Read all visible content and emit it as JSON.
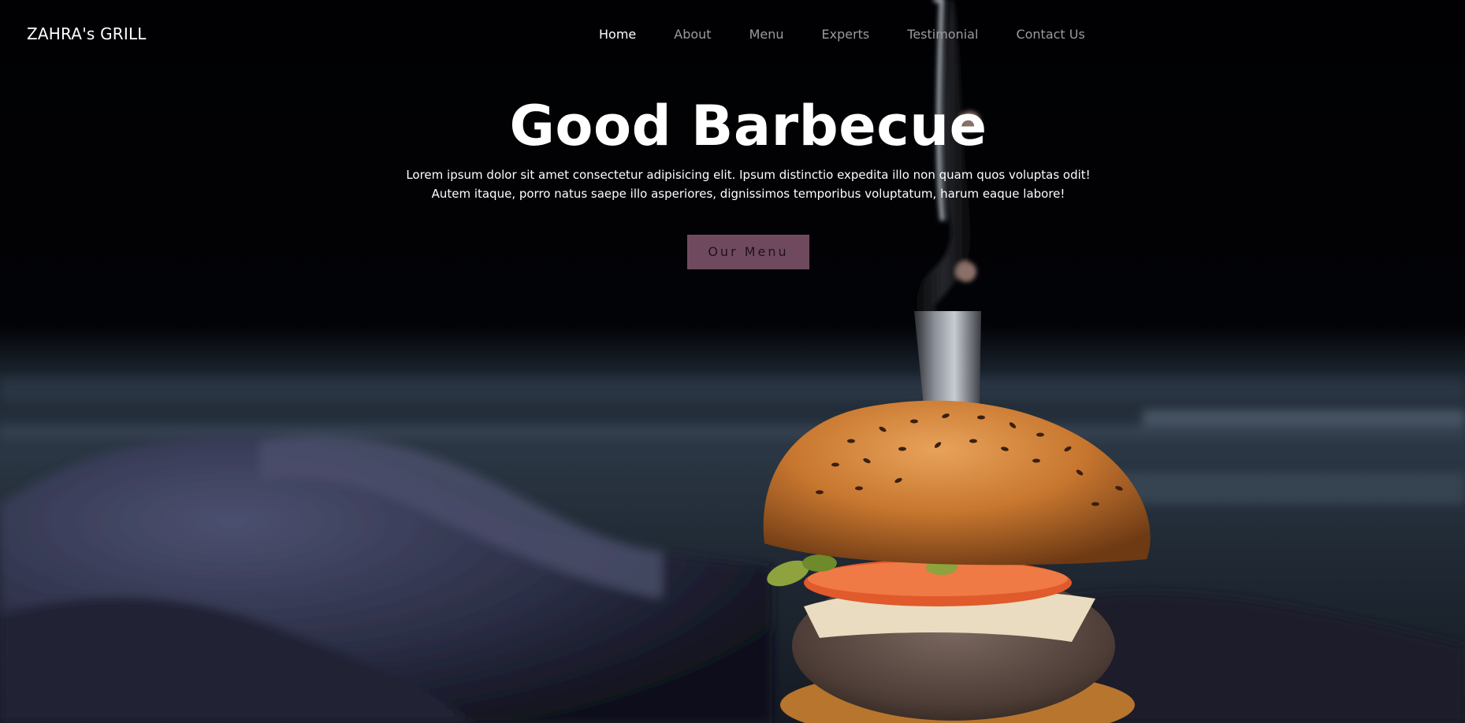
{
  "brand": {
    "name": "ZAHRA's GRILL"
  },
  "nav": {
    "items": [
      {
        "label": "Home",
        "active": true
      },
      {
        "label": "About",
        "active": false
      },
      {
        "label": "Menu",
        "active": false
      },
      {
        "label": "Experts",
        "active": false
      },
      {
        "label": "Testimonial",
        "active": false
      },
      {
        "label": "Contact Us",
        "active": false
      }
    ]
  },
  "hero": {
    "title": "Good Barbecue",
    "description": "Lorem ipsum dolor sit amet consectetur adipisicing elit. Ipsum distinctio expedita illo non quam quos voluptas odit! Autem itaque, porro natus saepe illo asperiores, dignissimos temporibus voluptatum, harum eaque labore!",
    "cta_label": "Our Menu",
    "background_image": "burger-with-knife-photo"
  },
  "colors": {
    "background": "#000000",
    "nav_active": "#ffffff",
    "nav_inactive": "#9b9b9b",
    "cta_background": "#6f4a5e",
    "cta_text": "#1f1219"
  }
}
